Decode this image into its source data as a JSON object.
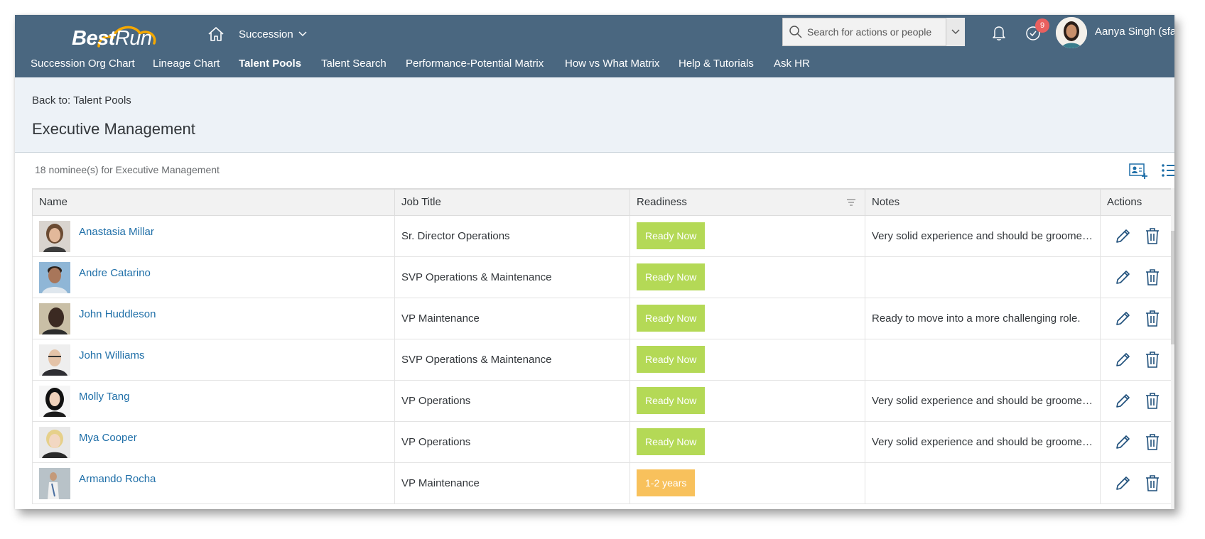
{
  "header": {
    "logo_text_best": "Best",
    "logo_text_run": "Run",
    "module": "Succession",
    "search_placeholder": "Search for actions or people",
    "todo_count": "9",
    "user_name": "Aanya Singh (sfadmi"
  },
  "nav": {
    "items": [
      {
        "label": "Succession Org Chart",
        "active": false
      },
      {
        "label": "Lineage Chart",
        "active": false
      },
      {
        "label": "Talent Pools",
        "active": true
      },
      {
        "label": "Talent Search",
        "active": false
      },
      {
        "label": "Performance-Potential Matrix",
        "active": false
      },
      {
        "label": "How vs What Matrix",
        "active": false
      },
      {
        "label": "Help & Tutorials",
        "active": false
      },
      {
        "label": "Ask HR",
        "active": false
      }
    ]
  },
  "page": {
    "back_link": "Back to: Talent Pools",
    "title": "Executive Management",
    "nominee_count": "18 nominee(s) for Executive Management"
  },
  "table": {
    "columns": [
      "Name",
      "Job Title",
      "Readiness",
      "Notes",
      "Actions"
    ],
    "rows": [
      {
        "name": "Anastasia Millar",
        "job_title": "Sr. Director Operations",
        "readiness": "Ready Now",
        "readiness_type": "ready",
        "notes": "Very solid experience and should be groomed for a leadership role."
      },
      {
        "name": "Andre Catarino",
        "job_title": "SVP Operations & Maintenance",
        "readiness": "Ready Now",
        "readiness_type": "ready",
        "notes": ""
      },
      {
        "name": "John Huddleson",
        "job_title": "VP Maintenance",
        "readiness": "Ready Now",
        "readiness_type": "ready",
        "notes": "Ready to move into a more challenging role."
      },
      {
        "name": "John Williams",
        "job_title": "SVP Operations & Maintenance",
        "readiness": "Ready Now",
        "readiness_type": "ready",
        "notes": ""
      },
      {
        "name": "Molly Tang",
        "job_title": "VP Operations",
        "readiness": "Ready Now",
        "readiness_type": "ready",
        "notes": "Very solid experience and should be groomed for a leadership role."
      },
      {
        "name": "Mya Cooper",
        "job_title": "VP Operations",
        "readiness": "Ready Now",
        "readiness_type": "ready",
        "notes": "Very solid experience and should be groomed for a leadership role."
      },
      {
        "name": "Armando Rocha",
        "job_title": "VP Maintenance",
        "readiness": "1-2 years",
        "readiness_type": "years",
        "notes": ""
      }
    ]
  },
  "colors": {
    "header_bg": "#4a6780",
    "page_head_bg": "#edf2f7",
    "ready_now": "#b4d956",
    "years": "#f8c15c",
    "link": "#1f6fa8",
    "badge": "#e9605f"
  }
}
